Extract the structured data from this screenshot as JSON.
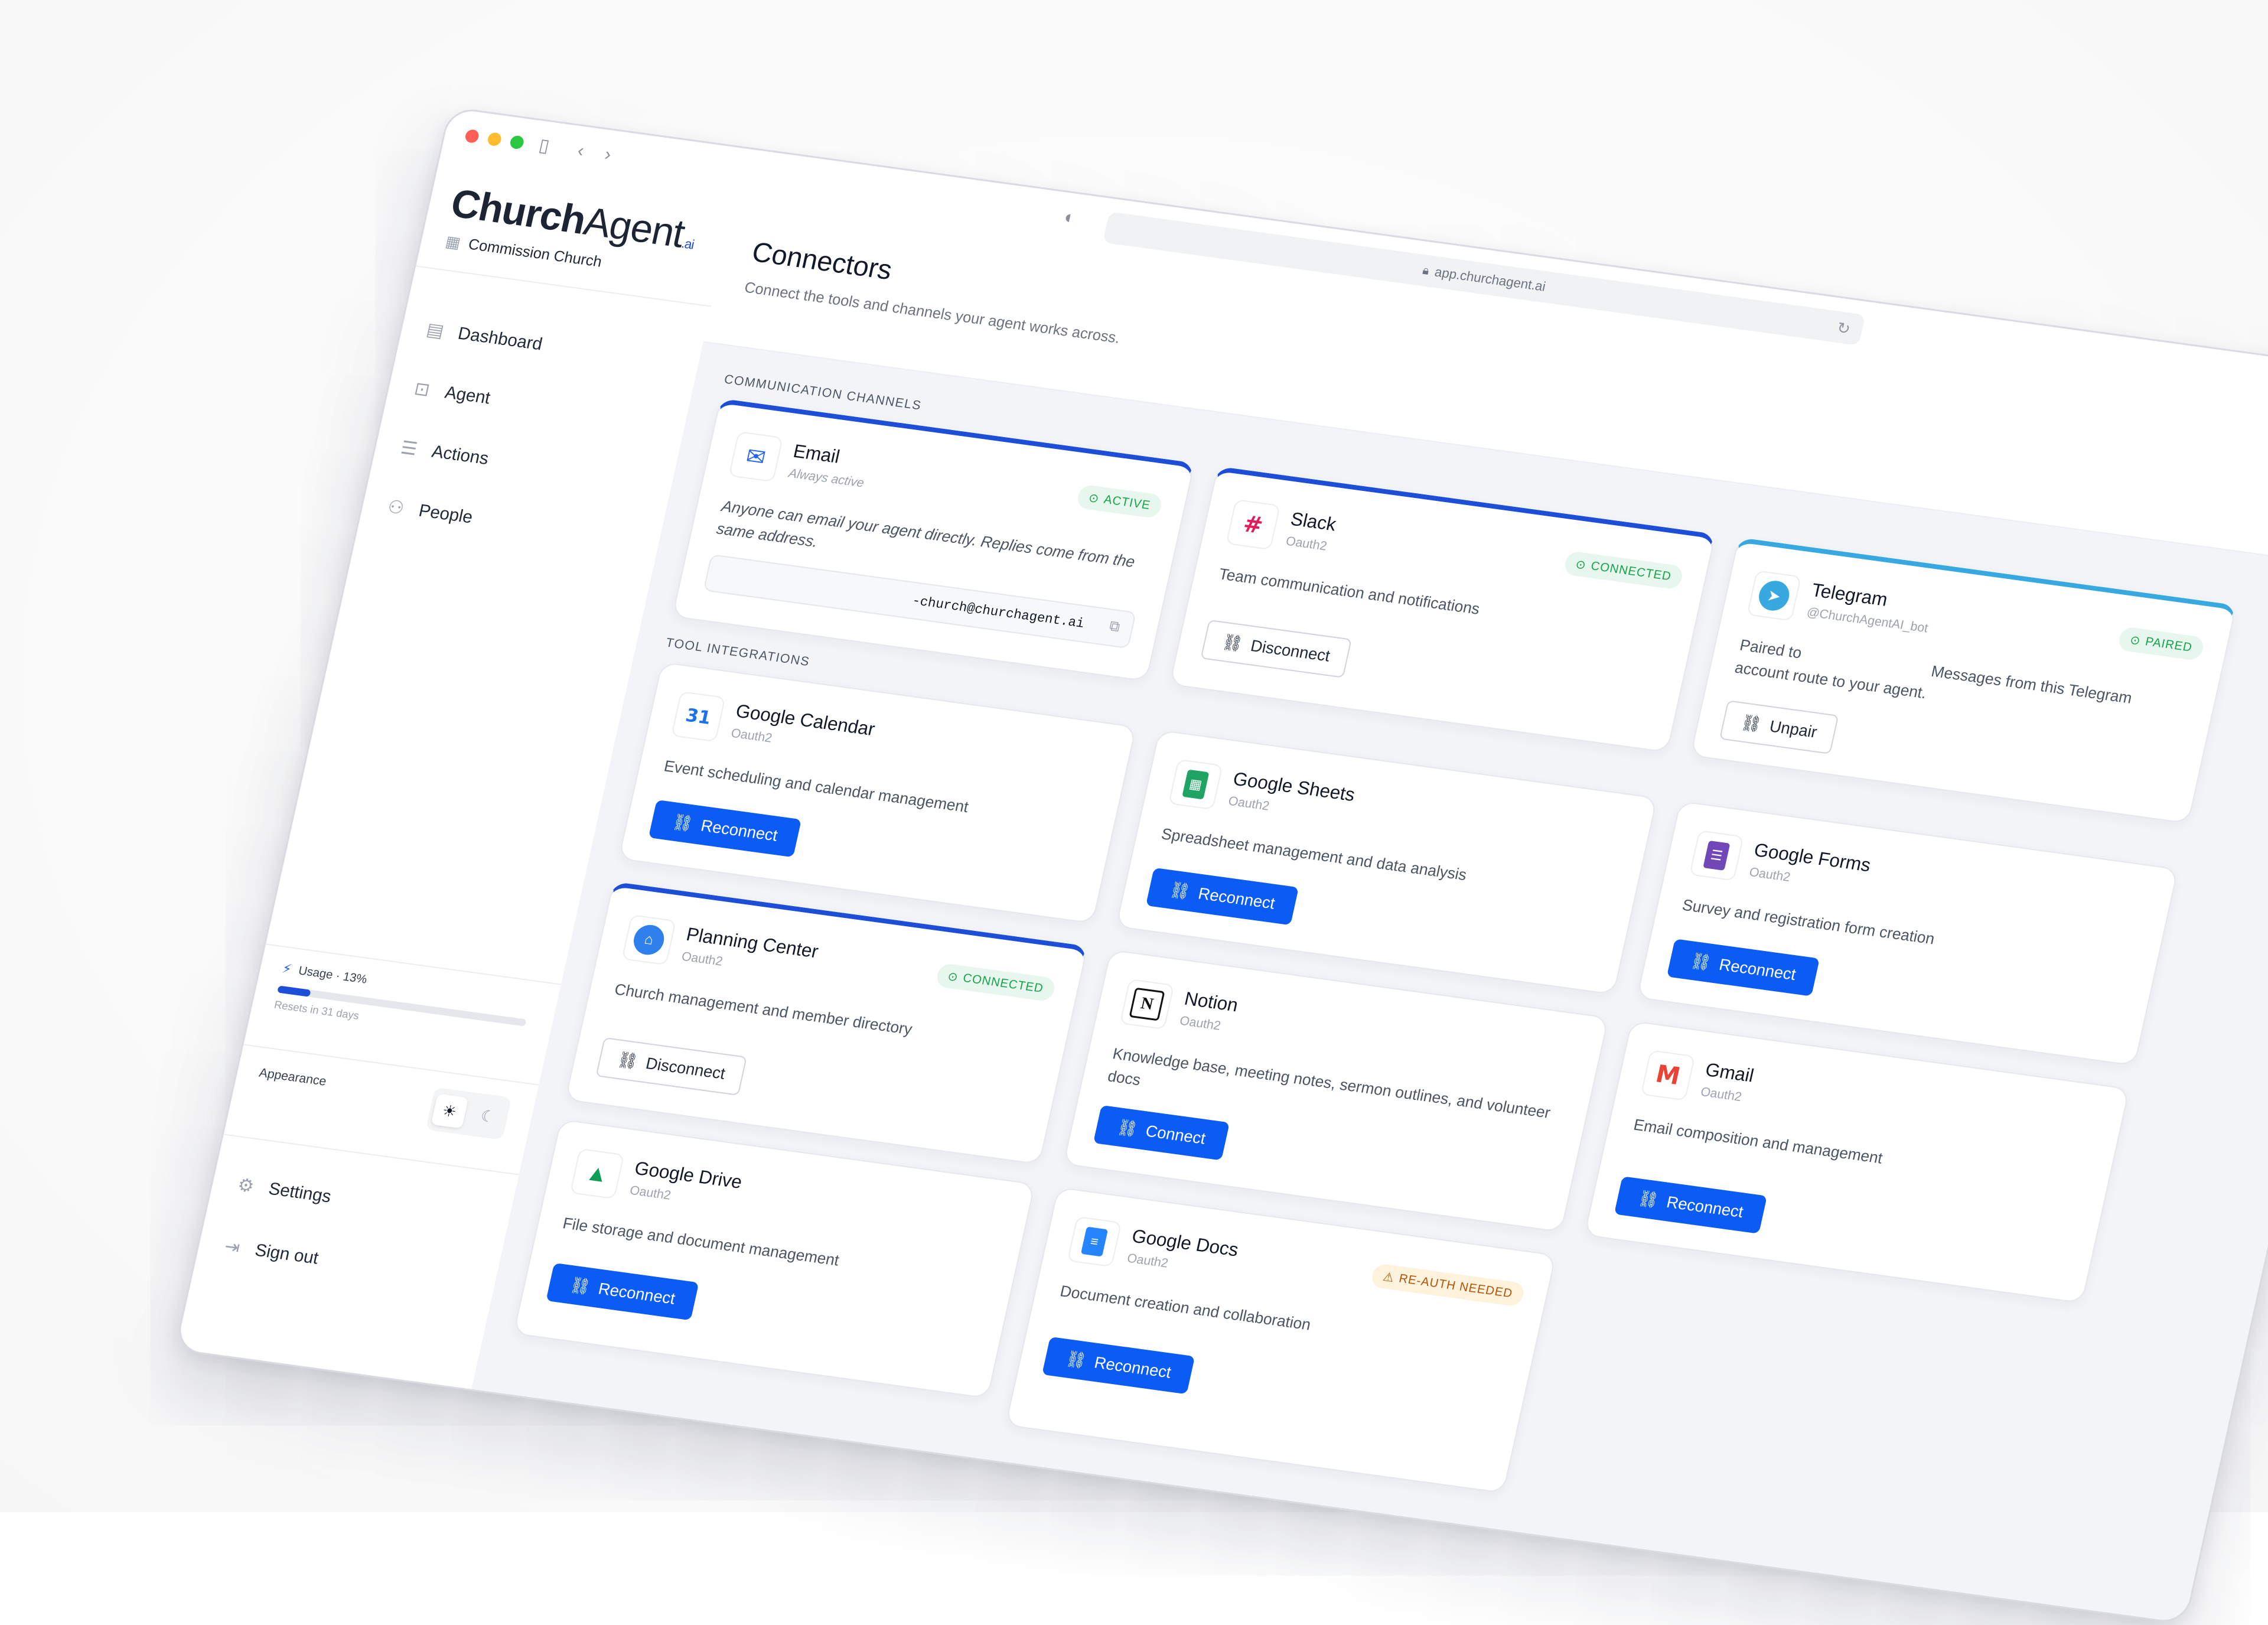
{
  "browser": {
    "url": "app.churchagent.ai"
  },
  "sidebar": {
    "logo_bold": "Church",
    "logo_rest": "Agent",
    "logo_suffix": ".ai",
    "church_name": "Commission Church",
    "nav": [
      {
        "label": "Dashboard",
        "icon": "grid-icon"
      },
      {
        "label": "Agent",
        "icon": "robot-icon"
      },
      {
        "label": "Actions",
        "icon": "checklist-icon"
      },
      {
        "label": "People",
        "icon": "people-icon"
      }
    ],
    "usage": {
      "label": "Usage · 13%",
      "percent": 13,
      "resets": "Resets in 31 days"
    },
    "appearance": {
      "label": "Appearance",
      "mode": "light"
    },
    "bottom": [
      {
        "label": "Settings",
        "icon": "gear-icon"
      },
      {
        "label": "Sign out",
        "icon": "signout-icon"
      }
    ]
  },
  "header": {
    "title": "Connectors",
    "subtitle": "Connect the tools and channels your agent works across."
  },
  "sections": {
    "channels": "Communication Channels",
    "tools": "Tool Integrations"
  },
  "channels": {
    "email": {
      "name": "Email",
      "sub": "Always active",
      "badge": "ACTIVE",
      "desc": "Anyone can email your agent directly. Replies come from the same address.",
      "address": "-church@churchagent.ai"
    },
    "slack": {
      "name": "Slack",
      "sub": "Oauth2",
      "badge": "CONNECTED",
      "desc": "Team communication and notifications",
      "button": "Disconnect"
    },
    "telegram": {
      "name": "Telegram",
      "sub": "@ChurchAgentAI_bot",
      "badge": "PAIRED",
      "desc_a": "Paired to",
      "desc_b": "Messages from this Telegram account route to your agent.",
      "button": "Unpair"
    }
  },
  "tools": {
    "gcal": {
      "name": "Google Calendar",
      "sub": "Oauth2",
      "desc": "Event scheduling and calendar management",
      "button": "Reconnect"
    },
    "gsheets": {
      "name": "Google Sheets",
      "sub": "Oauth2",
      "desc": "Spreadsheet management and data analysis",
      "button": "Reconnect"
    },
    "gforms": {
      "name": "Google Forms",
      "sub": "Oauth2",
      "desc": "Survey and registration form creation",
      "button": "Reconnect"
    },
    "pco": {
      "name": "Planning Center",
      "sub": "Oauth2",
      "badge": "CONNECTED",
      "desc": "Church management and member directory",
      "button": "Disconnect"
    },
    "notion": {
      "name": "Notion",
      "sub": "Oauth2",
      "desc": "Knowledge base, meeting notes, sermon outlines, and volunteer docs",
      "button": "Connect"
    },
    "gmail": {
      "name": "Gmail",
      "sub": "Oauth2",
      "desc": "Email composition and management",
      "button": "Reconnect"
    },
    "gdrive": {
      "name": "Google Drive",
      "sub": "Oauth2",
      "desc": "File storage and document management",
      "button": "Reconnect"
    },
    "gdocs": {
      "name": "Google Docs",
      "sub": "Oauth2",
      "badge": "RE-AUTH NEEDED",
      "desc": "Document creation and collaboration",
      "button": "Reconnect"
    }
  },
  "colors": {
    "accent": "#0b5cf5",
    "success": "#16a34a",
    "warning": "#b45309",
    "telegram": "#38a9e0"
  }
}
